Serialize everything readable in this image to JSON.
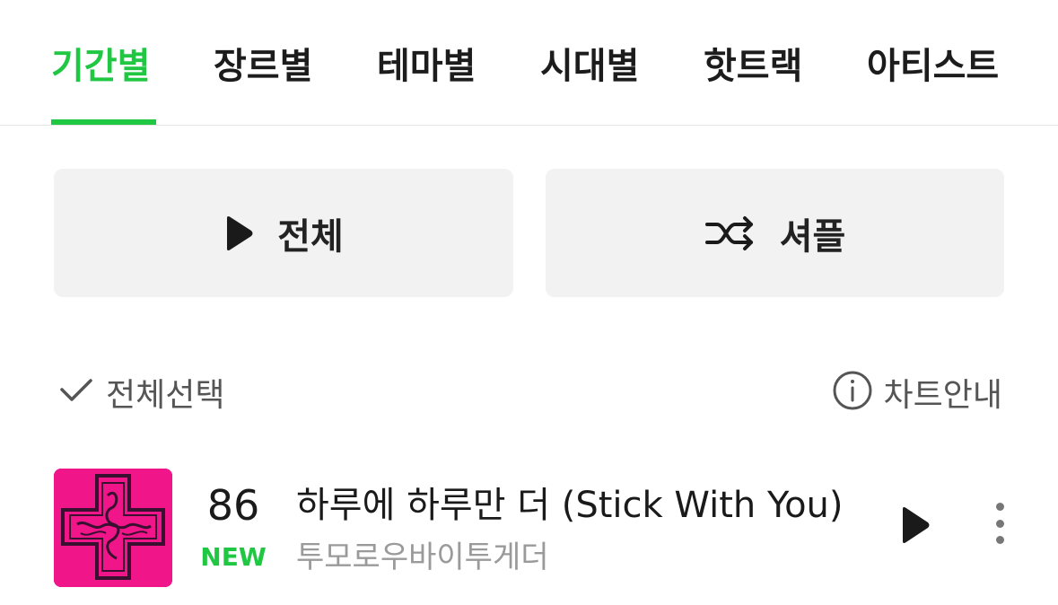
{
  "tabs": [
    {
      "label": "기간별",
      "active": true
    },
    {
      "label": "장르별",
      "active": false
    },
    {
      "label": "테마별",
      "active": false
    },
    {
      "label": "시대별",
      "active": false
    },
    {
      "label": "핫트랙",
      "active": false
    },
    {
      "label": "아티스트",
      "active": false
    }
  ],
  "actions": {
    "play_all_label": "전체",
    "shuffle_label": "셔플"
  },
  "list_controls": {
    "select_all_label": "전체선택",
    "chart_info_label": "차트안내"
  },
  "tracks": [
    {
      "rank": "86",
      "rank_status": "NEW",
      "title": "하루에 하루만 더 (Stick With You)",
      "artist": "투모로우바이투게더"
    }
  ],
  "colors": {
    "accent": "#1fc742",
    "cover": "#f0168a",
    "button_bg": "#f2f2f2"
  },
  "icons": {
    "play": "play-icon",
    "shuffle": "shuffle-icon",
    "check": "check-icon",
    "info": "info-icon",
    "more": "more-vertical-icon"
  }
}
